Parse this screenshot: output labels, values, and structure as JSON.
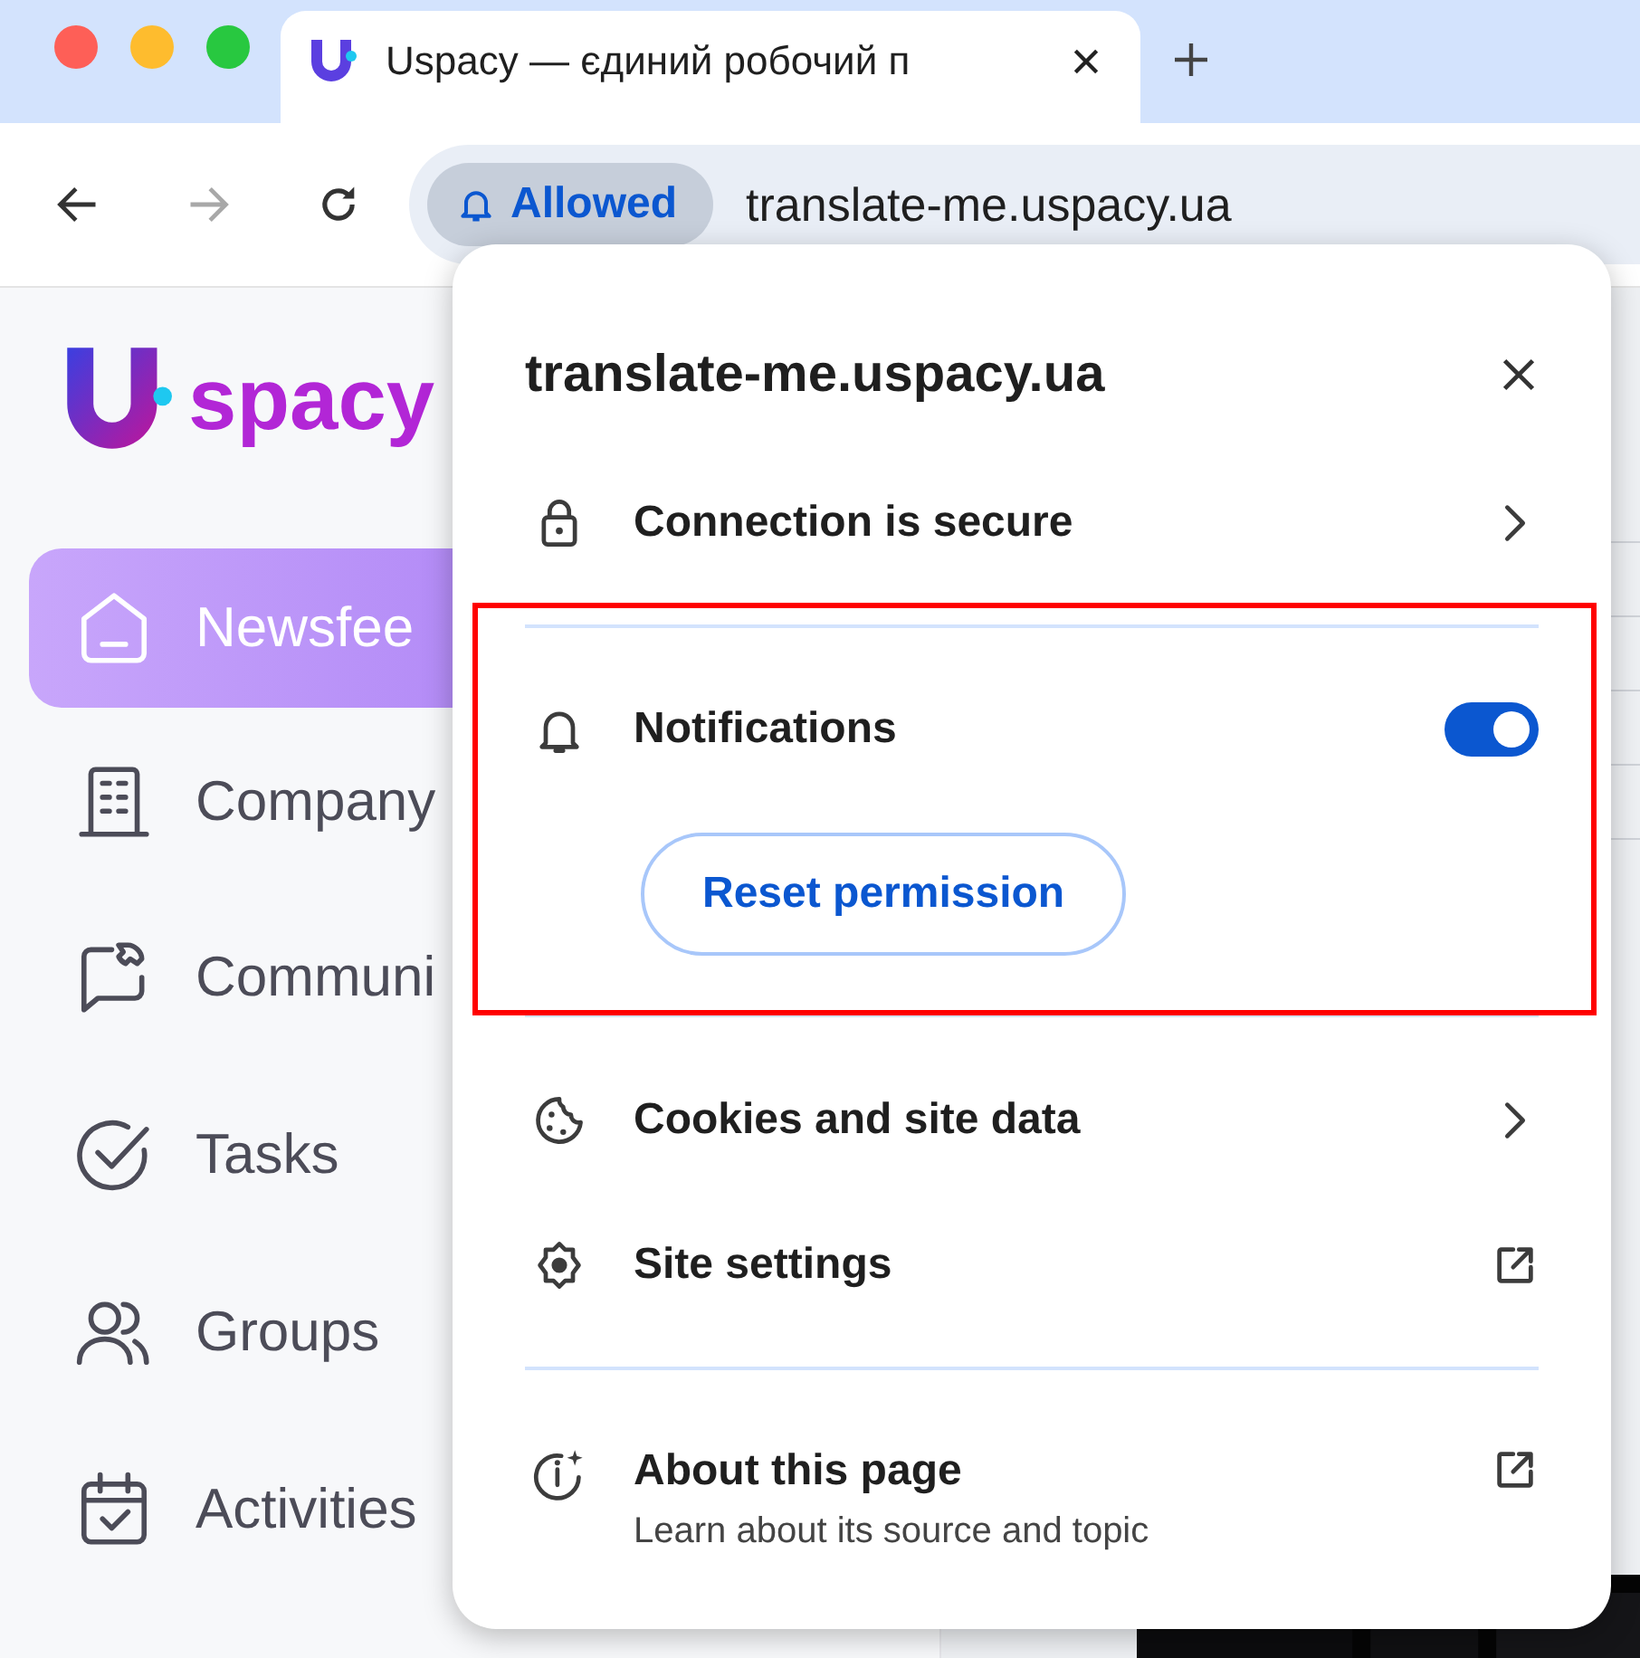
{
  "tabs": [
    {
      "title": "Uspacy — єдиний робочий п",
      "selected": true
    }
  ],
  "toolbar": {
    "permission_chip": "Allowed",
    "url": "translate-me.uspacy.ua"
  },
  "sidebar": {
    "logo_text": "spacy",
    "items": [
      {
        "label": "Newsfee",
        "kind": "home",
        "selected": true
      },
      {
        "label": "Company",
        "kind": "building",
        "selected": false
      },
      {
        "label": "Communi",
        "kind": "chat",
        "selected": false
      },
      {
        "label": "Tasks",
        "kind": "check",
        "selected": false
      },
      {
        "label": "Groups",
        "kind": "people",
        "selected": false
      },
      {
        "label": "Activities",
        "kind": "calendar",
        "selected": false
      }
    ]
  },
  "popup": {
    "title": "translate-me.uspacy.ua",
    "connection": "Connection is secure",
    "notifications": {
      "label": "Notifications",
      "on": true,
      "reset_button": "Reset permission",
      "highlighted": true
    },
    "items": [
      {
        "label": "Cookies and site data",
        "kind": "cookie",
        "opens_externally": false
      },
      {
        "label": "Site settings",
        "kind": "gear",
        "opens_externally": true
      }
    ],
    "about": {
      "label": "About this page",
      "subtitle": "Learn about its source and topic"
    }
  }
}
